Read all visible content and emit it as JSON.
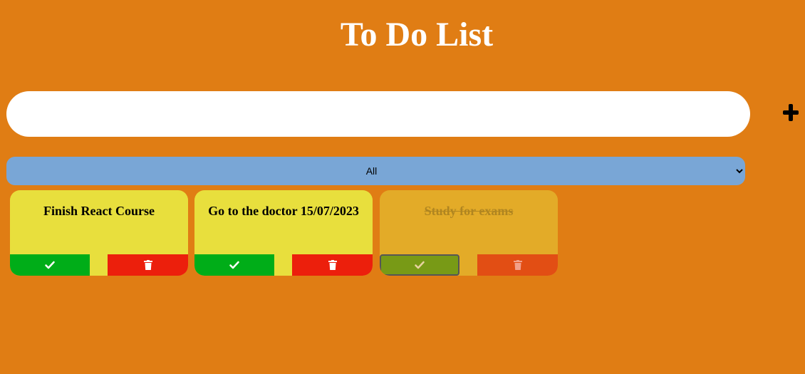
{
  "header": {
    "title": "To Do List"
  },
  "new_todo": {
    "value": "",
    "placeholder": ""
  },
  "add_button": {
    "icon": "plus-icon"
  },
  "filter": {
    "selected": "All",
    "options": [
      "All"
    ]
  },
  "todos": [
    {
      "text": "Finish React Course",
      "completed": false
    },
    {
      "text": "Go to the doctor 15/07/2023",
      "completed": false
    },
    {
      "text": "Study for exams",
      "completed": true
    }
  ],
  "colors": {
    "background": "#e07d14",
    "card": "#e8df3d",
    "card_completed": "#e3ab28",
    "check": "#00ad18",
    "trash": "#ec1f0c",
    "filter": "#79a6d6"
  }
}
